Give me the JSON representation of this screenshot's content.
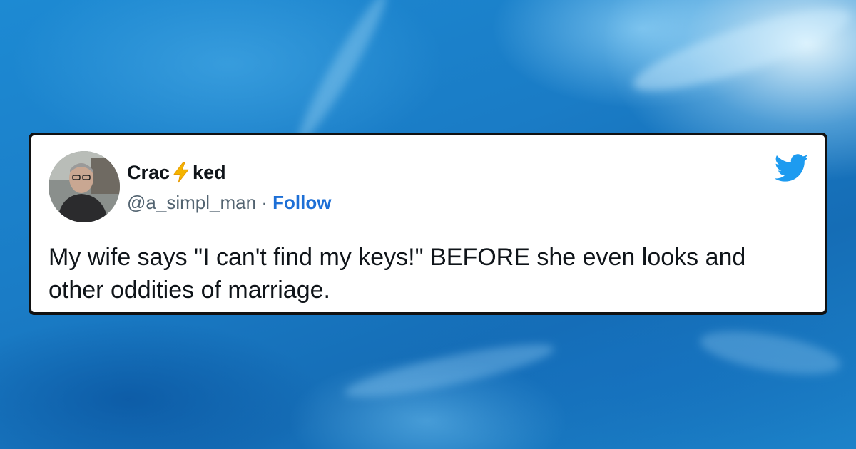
{
  "tweet": {
    "display_name_start": "Crac",
    "display_name_end": "ked",
    "handle": "@a_simpl_man",
    "separator": "·",
    "follow_label": "Follow",
    "text": "My wife says \"I can't find my keys!\" BEFORE she even looks and other oddities of marriage."
  },
  "icons": {
    "name_emoji": "lightning-bolt-icon",
    "brand": "twitter-bird-icon"
  },
  "colors": {
    "background_accent": "#1a7fc9",
    "card_border": "#111111",
    "follow_link": "#1d6fd6",
    "twitter_blue": "#1d9bf0",
    "bolt": "#f4b400",
    "handle_gray": "#536471"
  }
}
